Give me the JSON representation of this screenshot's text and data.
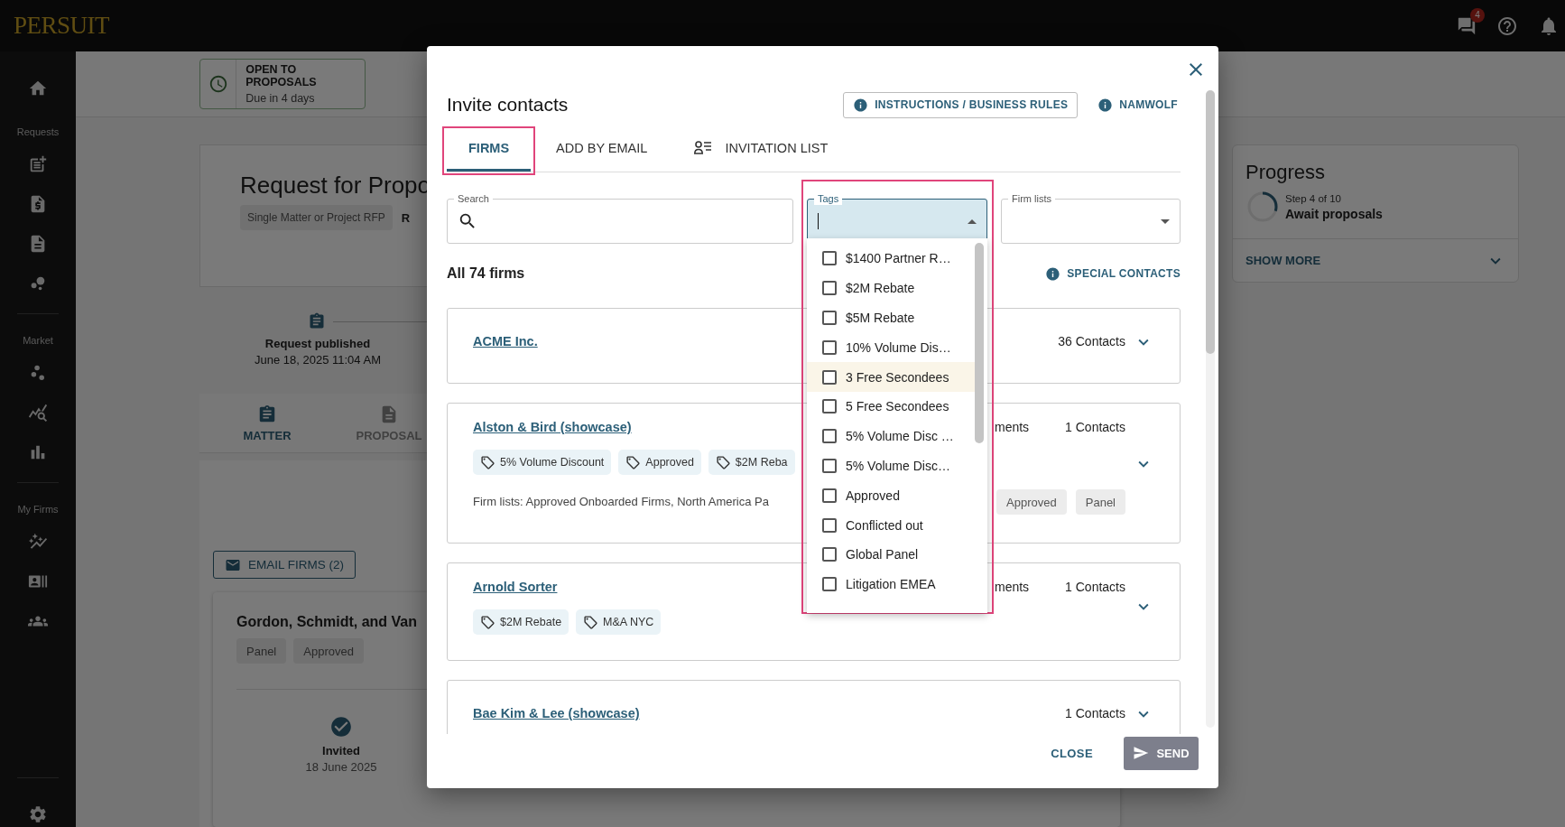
{
  "topbar": {
    "logo": "PERSUIT",
    "message_count": "4"
  },
  "sidebar": {
    "sections": [
      {
        "label": "Requests"
      },
      {
        "label": "Market"
      },
      {
        "label": "My Firms"
      }
    ]
  },
  "status": {
    "title": "OPEN TO PROPOSALS",
    "subtitle": "Due in 4 days"
  },
  "request": {
    "title": "Request for Propo",
    "type": "Single Matter or Project RFP",
    "cut_label": "R"
  },
  "timeline": {
    "event": "Request published",
    "date": "June 18, 2025 11:04 AM"
  },
  "page_tabs": [
    {
      "label": "MATTER",
      "selected": true
    },
    {
      "label": "PROPOSAL",
      "selected": false
    }
  ],
  "email_button": "EMAIL FIRMS (2)",
  "invited_firm": {
    "name": "Gordon, Schmidt, and Van",
    "chips": [
      "Panel",
      "Approved"
    ],
    "step": "Invited",
    "date": "18 June 2025",
    "done": true
  },
  "progress": {
    "title": "Progress",
    "step": "Step 4 of 10",
    "stage": "Await proposals",
    "level": 0.3,
    "show_more": "SHOW MORE"
  },
  "dialog": {
    "title": "Invite contacts",
    "header_buttons": [
      {
        "label": "INSTRUCTIONS / BUSINESS RULES",
        "kind": "outlined"
      },
      {
        "label": "NAMWOLF",
        "kind": "text"
      }
    ],
    "tabs": [
      {
        "label": "FIRMS",
        "selected": true,
        "highlighted": true,
        "with_icon": false
      },
      {
        "label": "ADD BY EMAIL",
        "selected": false,
        "highlighted": false,
        "with_icon": false
      },
      {
        "label": "INVITATION LIST",
        "selected": false,
        "highlighted": false,
        "with_icon": true
      }
    ],
    "search": {
      "label": "Search"
    },
    "tags": {
      "label": "Tags",
      "focused": true,
      "highlighted": true,
      "options": [
        {
          "label": "$1400 Partner R…",
          "checked": false,
          "hovered": false
        },
        {
          "label": "$2M Rebate",
          "checked": false,
          "hovered": false
        },
        {
          "label": "$5M Rebate",
          "checked": false,
          "hovered": false
        },
        {
          "label": "10% Volume Dis…",
          "checked": false,
          "hovered": false
        },
        {
          "label": "3 Free Secondees",
          "checked": false,
          "hovered": true
        },
        {
          "label": "5 Free Secondees",
          "checked": false,
          "hovered": false
        },
        {
          "label": "5% Volume Disc …",
          "checked": false,
          "hovered": false
        },
        {
          "label": "5% Volume Disc…",
          "checked": false,
          "hovered": false
        },
        {
          "label": "Approved",
          "checked": false,
          "hovered": false
        },
        {
          "label": "Conflicted out",
          "checked": false,
          "hovered": false
        },
        {
          "label": "Global Panel",
          "checked": false,
          "hovered": false
        },
        {
          "label": "Litigation EMEA",
          "checked": false,
          "hovered": false
        }
      ]
    },
    "firm_lists": {
      "label": "Firm lists"
    },
    "count": "All 74 firms",
    "special_contacts": "SPECIAL CONTACTS",
    "firms": [
      {
        "name": "ACME Inc.",
        "contacts": "36 Contacts"
      },
      {
        "name": "Alston & Bird (showcase)",
        "tags": [
          "5% Volume Discount",
          "Approved",
          "$2M Reba"
        ],
        "firm_lists": "Firm lists: Approved Onboarded Firms, North America Pa",
        "column_3": "ments",
        "contacts": "1 Contacts",
        "chips": [
          "Approved",
          "Panel"
        ]
      },
      {
        "name": "Arnold Sorter",
        "tags": [
          "$2M Rebate",
          "M&A NYC"
        ],
        "column_3": "ments",
        "contacts": "1 Contacts"
      },
      {
        "name": "Bae Kim & Lee (showcase)",
        "contacts": "1 Contacts"
      }
    ],
    "close": "CLOSE",
    "send": {
      "label": "SEND",
      "disabled": true
    }
  }
}
